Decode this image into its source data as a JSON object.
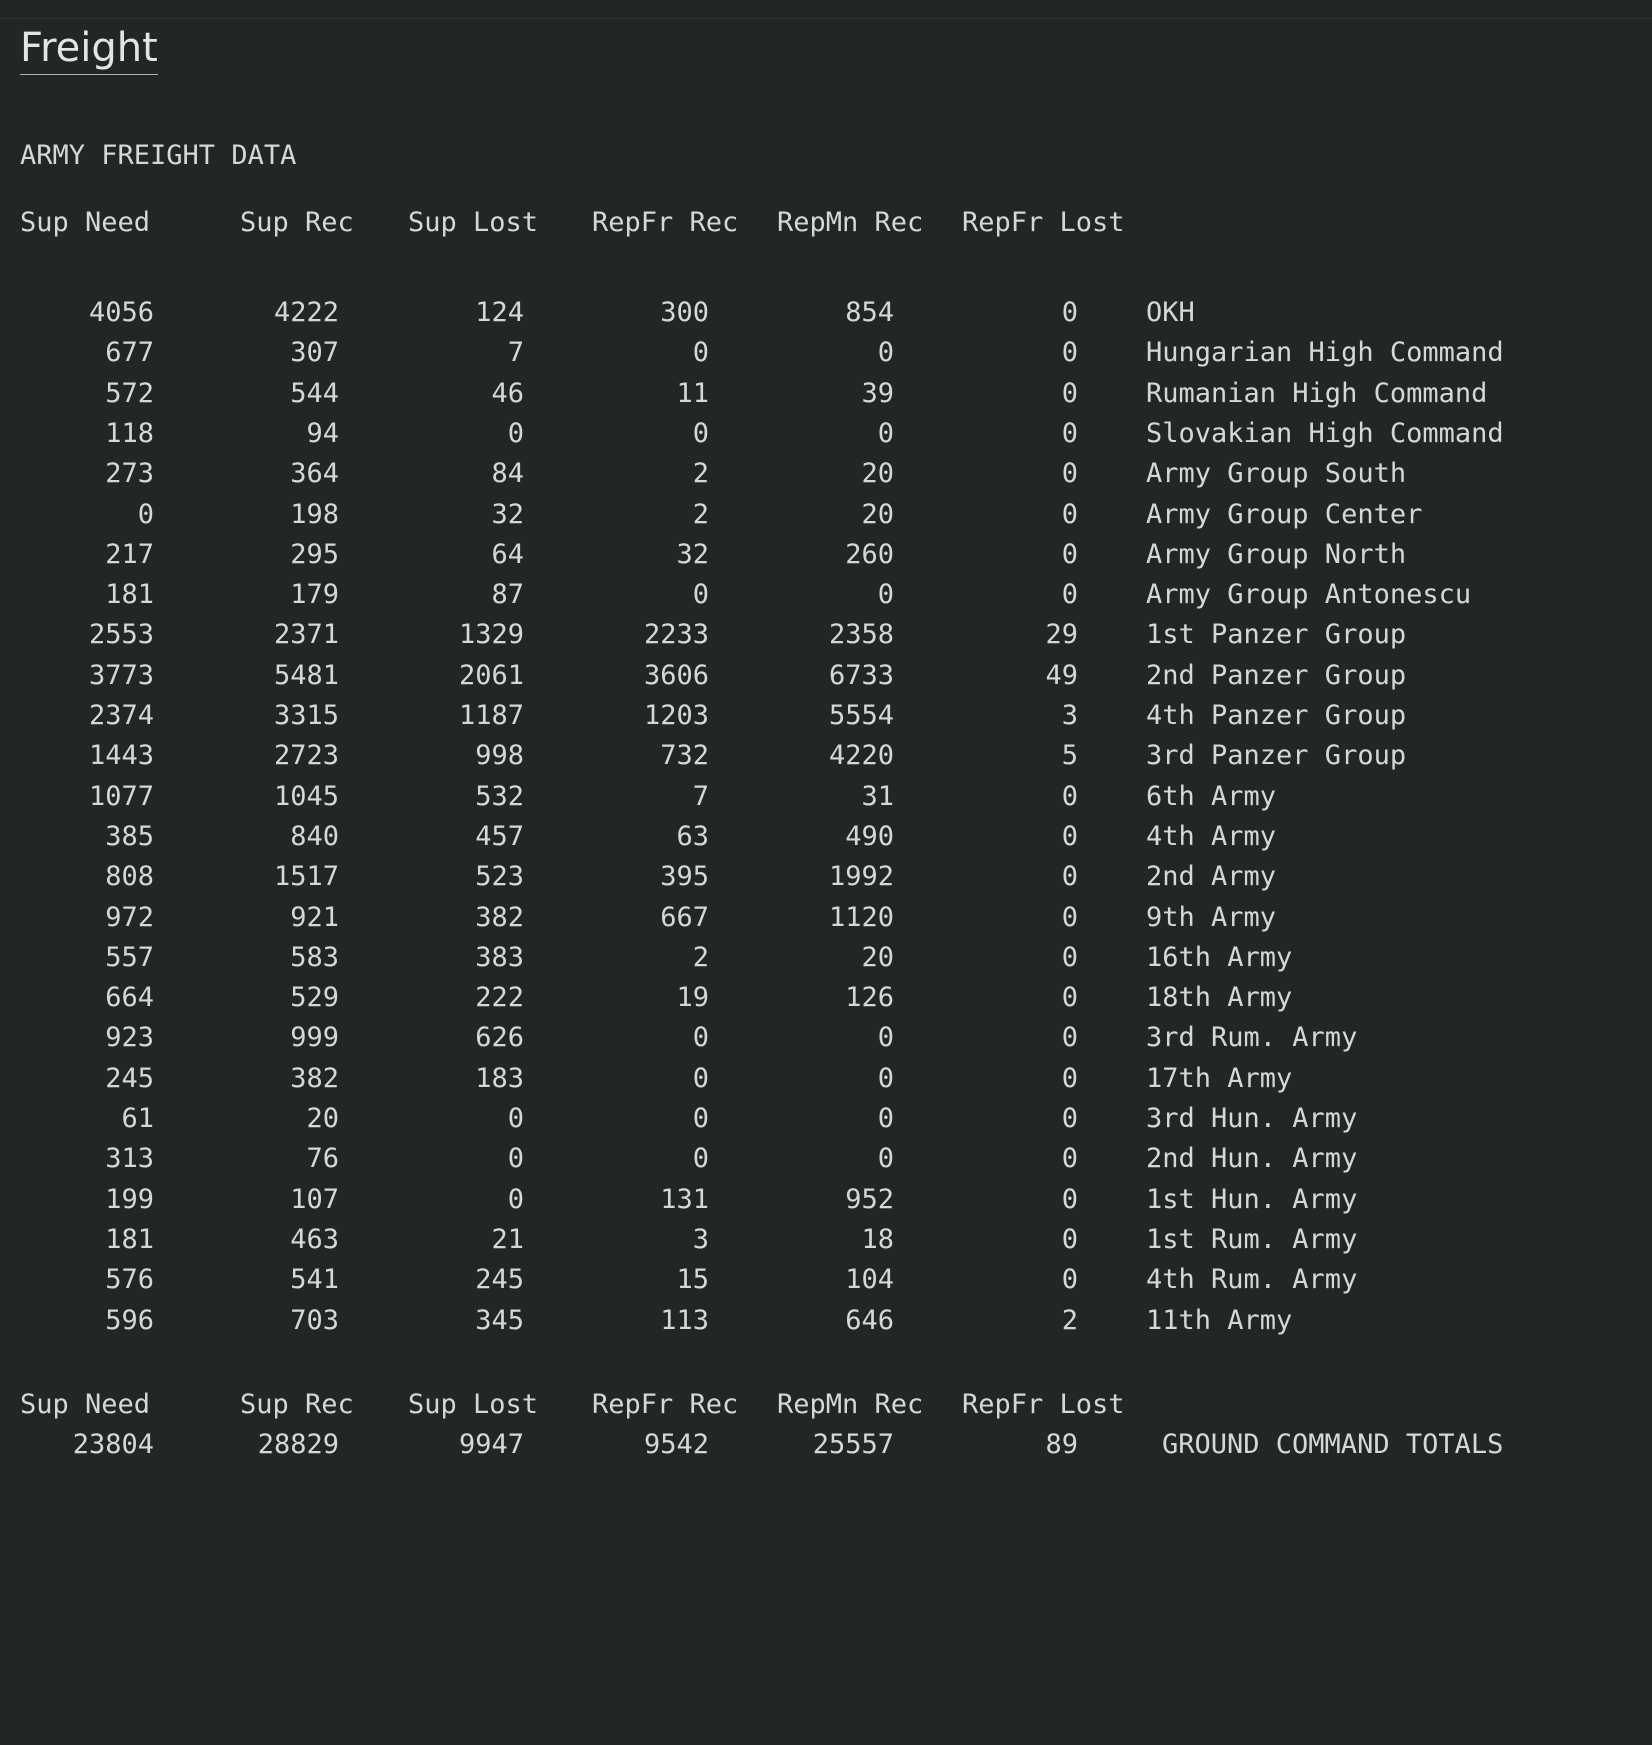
{
  "page": {
    "title": "Freight",
    "section_title": "ARMY FREIGHT DATA"
  },
  "columns": [
    "Sup Need",
    "Sup Rec",
    "Sup Lost",
    "RepFr Rec",
    "RepMn Rec",
    "RepFr Lost"
  ],
  "rows": [
    {
      "sup_need": "4056",
      "sup_rec": "4222",
      "sup_lost": "124",
      "repfr_rec": "300",
      "repmn_rec": "854",
      "repfr_lost": "0",
      "name": "OKH"
    },
    {
      "sup_need": "677",
      "sup_rec": "307",
      "sup_lost": "7",
      "repfr_rec": "0",
      "repmn_rec": "0",
      "repfr_lost": "0",
      "name": "Hungarian High Command"
    },
    {
      "sup_need": "572",
      "sup_rec": "544",
      "sup_lost": "46",
      "repfr_rec": "11",
      "repmn_rec": "39",
      "repfr_lost": "0",
      "name": "Rumanian High Command"
    },
    {
      "sup_need": "118",
      "sup_rec": "94",
      "sup_lost": "0",
      "repfr_rec": "0",
      "repmn_rec": "0",
      "repfr_lost": "0",
      "name": "Slovakian High Command"
    },
    {
      "sup_need": "273",
      "sup_rec": "364",
      "sup_lost": "84",
      "repfr_rec": "2",
      "repmn_rec": "20",
      "repfr_lost": "0",
      "name": "Army Group South"
    },
    {
      "sup_need": "0",
      "sup_rec": "198",
      "sup_lost": "32",
      "repfr_rec": "2",
      "repmn_rec": "20",
      "repfr_lost": "0",
      "name": "Army Group Center"
    },
    {
      "sup_need": "217",
      "sup_rec": "295",
      "sup_lost": "64",
      "repfr_rec": "32",
      "repmn_rec": "260",
      "repfr_lost": "0",
      "name": "Army Group North"
    },
    {
      "sup_need": "181",
      "sup_rec": "179",
      "sup_lost": "87",
      "repfr_rec": "0",
      "repmn_rec": "0",
      "repfr_lost": "0",
      "name": "Army Group Antonescu"
    },
    {
      "sup_need": "2553",
      "sup_rec": "2371",
      "sup_lost": "1329",
      "repfr_rec": "2233",
      "repmn_rec": "2358",
      "repfr_lost": "29",
      "name": "1st Panzer Group"
    },
    {
      "sup_need": "3773",
      "sup_rec": "5481",
      "sup_lost": "2061",
      "repfr_rec": "3606",
      "repmn_rec": "6733",
      "repfr_lost": "49",
      "name": "2nd Panzer Group"
    },
    {
      "sup_need": "2374",
      "sup_rec": "3315",
      "sup_lost": "1187",
      "repfr_rec": "1203",
      "repmn_rec": "5554",
      "repfr_lost": "3",
      "name": "4th Panzer Group"
    },
    {
      "sup_need": "1443",
      "sup_rec": "2723",
      "sup_lost": "998",
      "repfr_rec": "732",
      "repmn_rec": "4220",
      "repfr_lost": "5",
      "name": "3rd Panzer Group"
    },
    {
      "sup_need": "1077",
      "sup_rec": "1045",
      "sup_lost": "532",
      "repfr_rec": "7",
      "repmn_rec": "31",
      "repfr_lost": "0",
      "name": "6th Army"
    },
    {
      "sup_need": "385",
      "sup_rec": "840",
      "sup_lost": "457",
      "repfr_rec": "63",
      "repmn_rec": "490",
      "repfr_lost": "0",
      "name": "4th Army"
    },
    {
      "sup_need": "808",
      "sup_rec": "1517",
      "sup_lost": "523",
      "repfr_rec": "395",
      "repmn_rec": "1992",
      "repfr_lost": "0",
      "name": "2nd Army"
    },
    {
      "sup_need": "972",
      "sup_rec": "921",
      "sup_lost": "382",
      "repfr_rec": "667",
      "repmn_rec": "1120",
      "repfr_lost": "0",
      "name": "9th Army"
    },
    {
      "sup_need": "557",
      "sup_rec": "583",
      "sup_lost": "383",
      "repfr_rec": "2",
      "repmn_rec": "20",
      "repfr_lost": "0",
      "name": "16th Army"
    },
    {
      "sup_need": "664",
      "sup_rec": "529",
      "sup_lost": "222",
      "repfr_rec": "19",
      "repmn_rec": "126",
      "repfr_lost": "0",
      "name": "18th Army"
    },
    {
      "sup_need": "923",
      "sup_rec": "999",
      "sup_lost": "626",
      "repfr_rec": "0",
      "repmn_rec": "0",
      "repfr_lost": "0",
      "name": "3rd Rum. Army"
    },
    {
      "sup_need": "245",
      "sup_rec": "382",
      "sup_lost": "183",
      "repfr_rec": "0",
      "repmn_rec": "0",
      "repfr_lost": "0",
      "name": "17th Army"
    },
    {
      "sup_need": "61",
      "sup_rec": "20",
      "sup_lost": "0",
      "repfr_rec": "0",
      "repmn_rec": "0",
      "repfr_lost": "0",
      "name": "3rd Hun. Army"
    },
    {
      "sup_need": "313",
      "sup_rec": "76",
      "sup_lost": "0",
      "repfr_rec": "0",
      "repmn_rec": "0",
      "repfr_lost": "0",
      "name": "2nd Hun. Army"
    },
    {
      "sup_need": "199",
      "sup_rec": "107",
      "sup_lost": "0",
      "repfr_rec": "131",
      "repmn_rec": "952",
      "repfr_lost": "0",
      "name": "1st Hun. Army"
    },
    {
      "sup_need": "181",
      "sup_rec": "463",
      "sup_lost": "21",
      "repfr_rec": "3",
      "repmn_rec": "18",
      "repfr_lost": "0",
      "name": "1st Rum. Army"
    },
    {
      "sup_need": "576",
      "sup_rec": "541",
      "sup_lost": "245",
      "repfr_rec": "15",
      "repmn_rec": "104",
      "repfr_lost": "0",
      "name": "4th Rum. Army"
    },
    {
      "sup_need": "596",
      "sup_rec": "703",
      "sup_lost": "345",
      "repfr_rec": "113",
      "repmn_rec": "646",
      "repfr_lost": "2",
      "name": "11th Army"
    }
  ],
  "totals": {
    "sup_need": "23804",
    "sup_rec": "28829",
    "sup_lost": "9947",
    "repfr_rec": "9542",
    "repmn_rec": "25557",
    "repfr_lost": "89",
    "name": "GROUND COMMAND TOTALS"
  },
  "colors": {
    "background": "#222725",
    "text": "#d4d8d6"
  }
}
